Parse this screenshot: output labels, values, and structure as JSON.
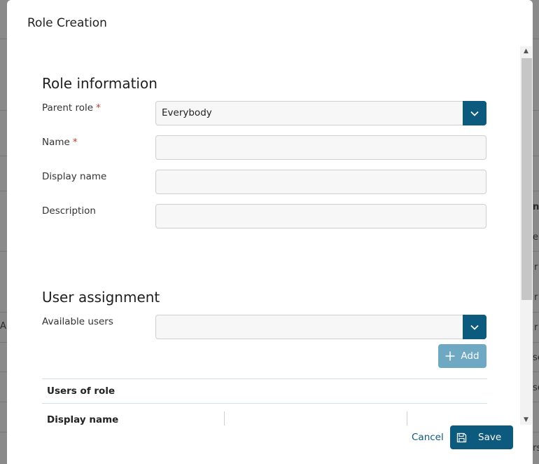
{
  "background": {
    "fragments": [
      "ne",
      "er",
      "r",
      "r",
      "r",
      "se",
      "se",
      "rs",
      "AD"
    ]
  },
  "modal": {
    "title": "Role Creation",
    "role_information": {
      "heading": "Role information",
      "parent_role": {
        "label": "Parent role",
        "required": "*",
        "value": "Everybody"
      },
      "name": {
        "label": "Name",
        "required": "*",
        "value": ""
      },
      "display_name": {
        "label": "Display name",
        "value": ""
      },
      "description": {
        "label": "Description",
        "value": ""
      }
    },
    "user_assignment": {
      "heading": "User assignment",
      "available_users": {
        "label": "Available users",
        "value": ""
      },
      "add_label": "Add",
      "table": {
        "caption": "Users of role",
        "columns": [
          "Display name",
          "",
          ""
        ]
      }
    },
    "footer": {
      "cancel_label": "Cancel",
      "save_label": "Save"
    }
  },
  "colors": {
    "accent": "#0c5a7d",
    "add_button_disabled": "#6ea8c2",
    "required": "#c0392b"
  }
}
